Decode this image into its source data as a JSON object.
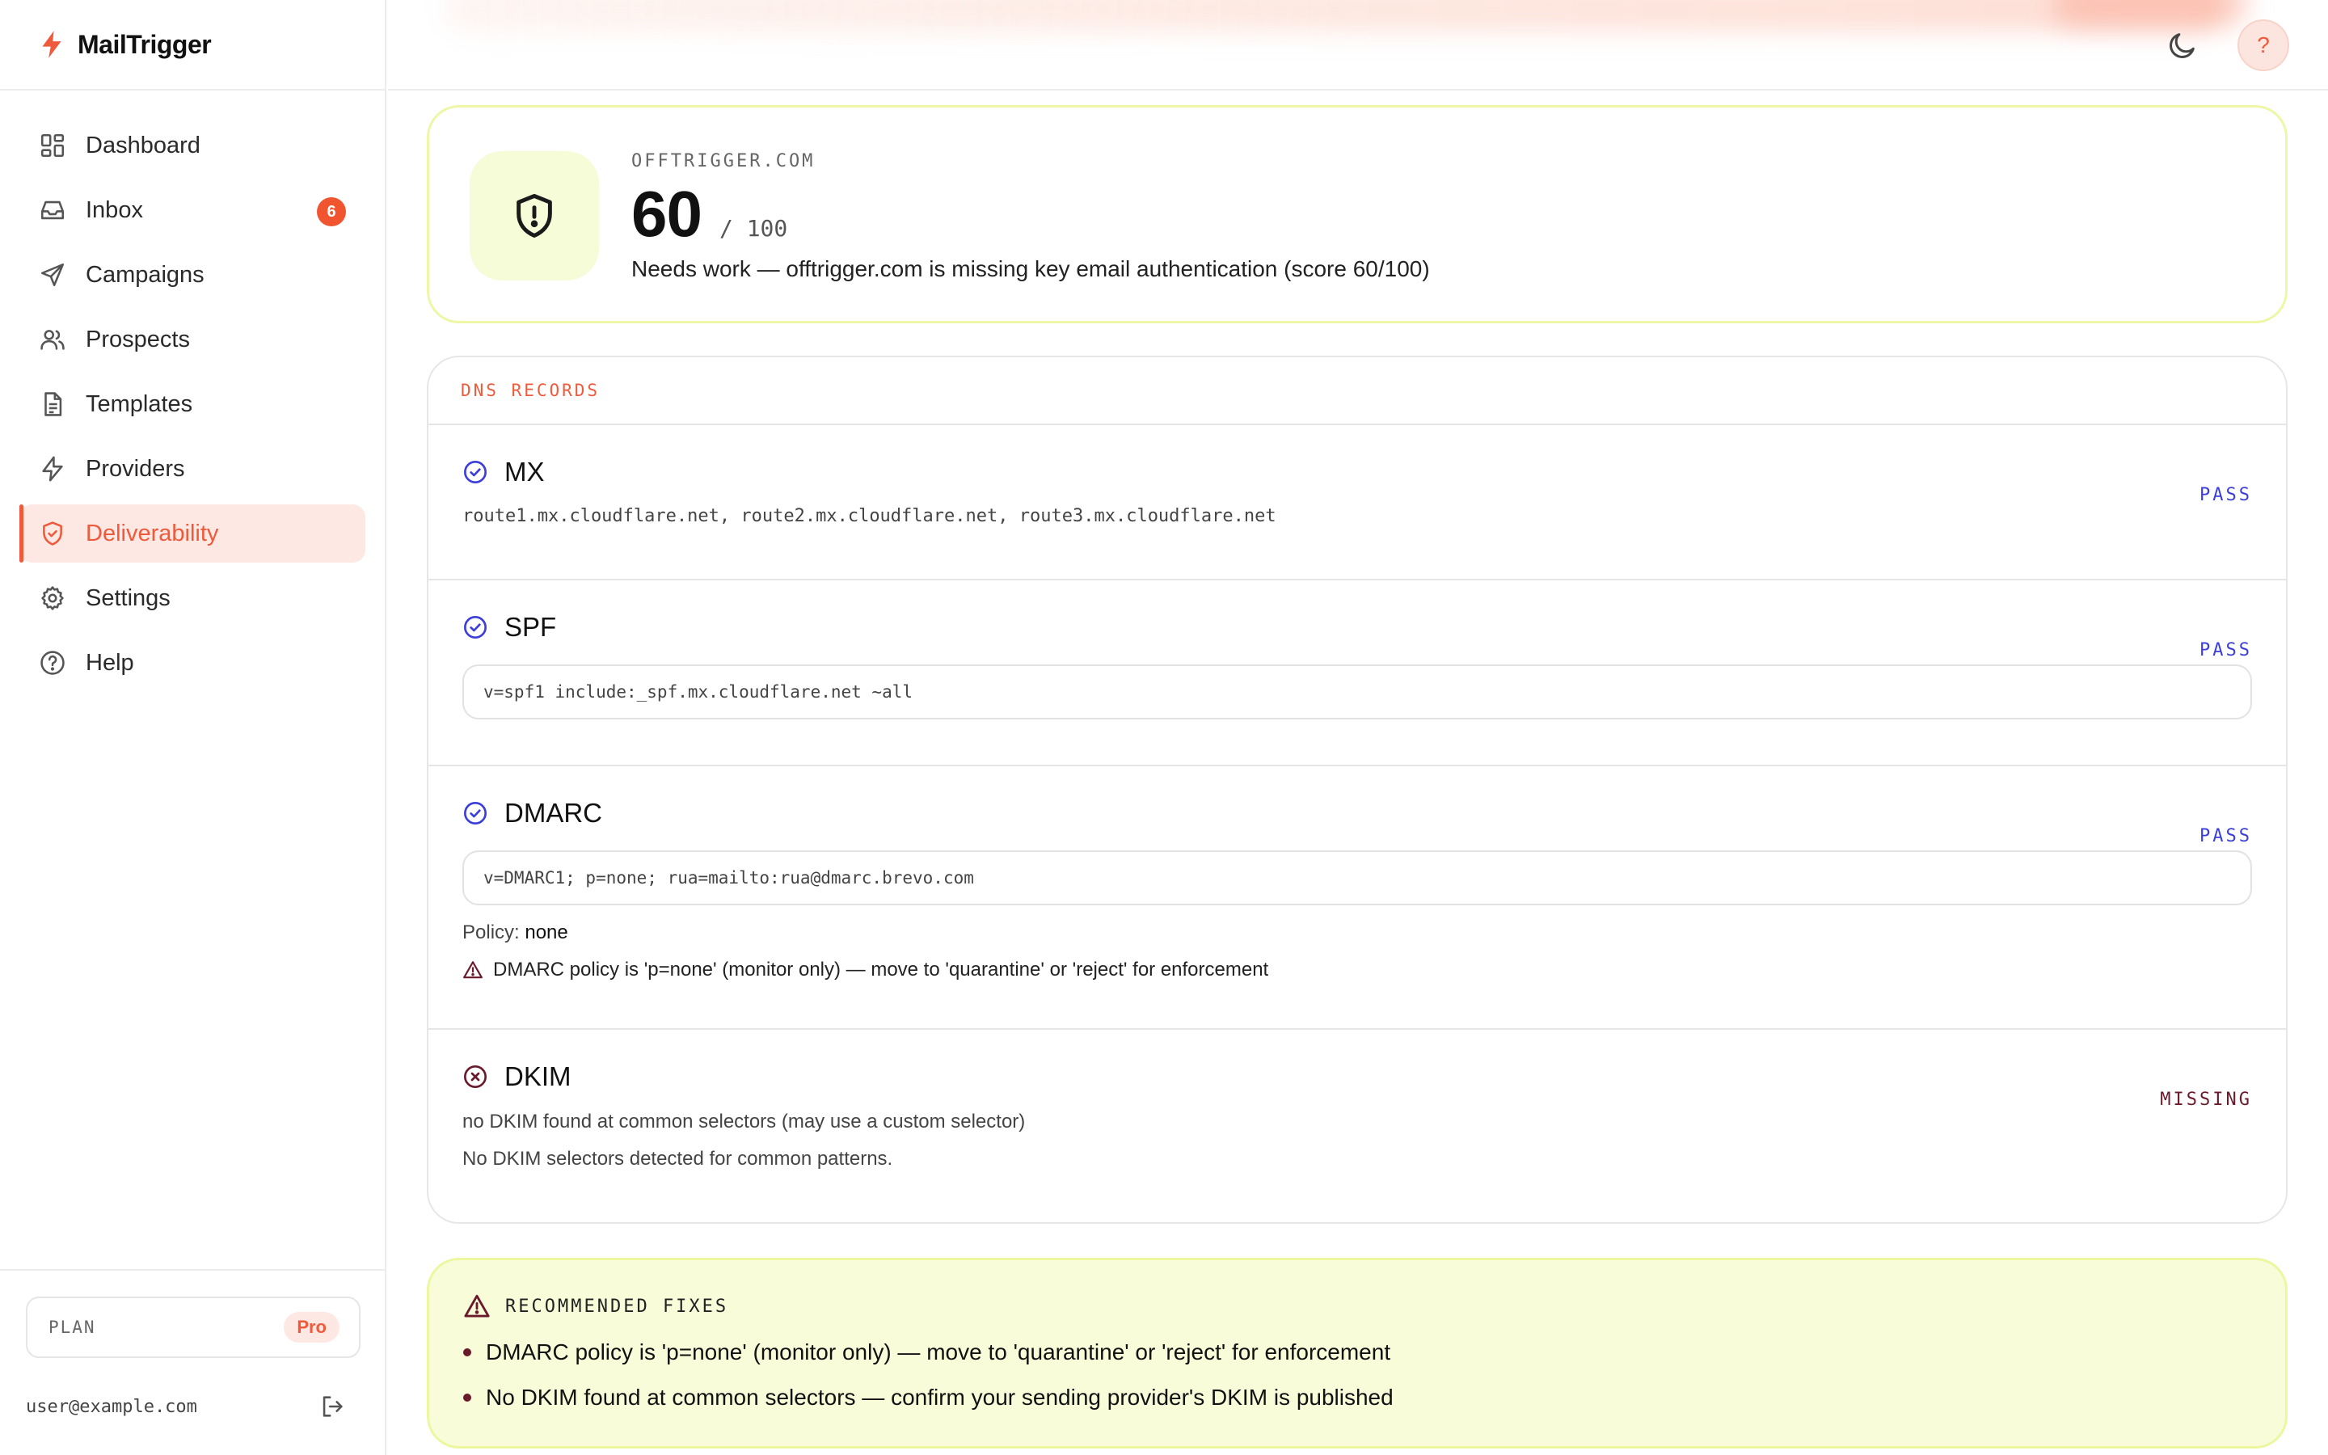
{
  "brand": {
    "name": "MailTrigger"
  },
  "sidebar": {
    "items": [
      {
        "label": "Dashboard",
        "icon": "dashboard-icon"
      },
      {
        "label": "Inbox",
        "icon": "inbox-icon",
        "badge": "6"
      },
      {
        "label": "Campaigns",
        "icon": "send-icon"
      },
      {
        "label": "Prospects",
        "icon": "users-icon"
      },
      {
        "label": "Templates",
        "icon": "document-icon"
      },
      {
        "label": "Providers",
        "icon": "bolt-icon"
      },
      {
        "label": "Deliverability",
        "icon": "shield-check-icon",
        "active": true
      },
      {
        "label": "Settings",
        "icon": "gear-icon"
      },
      {
        "label": "Help",
        "icon": "help-circle-icon"
      }
    ],
    "plan": {
      "label": "PLAN",
      "value": "Pro"
    },
    "user_email": "user@example.com"
  },
  "topbar": {
    "help_label": "?"
  },
  "score": {
    "domain": "OFFTRIGGER.COM",
    "value": "60",
    "max": "/ 100",
    "description": "Needs work — offtrigger.com is missing key email authentication (score 60/100)"
  },
  "dns": {
    "title": "DNS RECORDS",
    "records": {
      "mx": {
        "name": "MX",
        "status": "PASS",
        "value": "route1.mx.cloudflare.net, route2.mx.cloudflare.net, route3.mx.cloudflare.net"
      },
      "spf": {
        "name": "SPF",
        "status": "PASS",
        "value": "v=spf1 include:_spf.mx.cloudflare.net ~all"
      },
      "dmarc": {
        "name": "DMARC",
        "status": "PASS",
        "value": "v=DMARC1; p=none; rua=mailto:rua@dmarc.brevo.com",
        "policy_label": "Policy:",
        "policy_value": "none",
        "warning": "DMARC policy is 'p=none' (monitor only) — move to 'quarantine' or 'reject' for enforcement"
      },
      "dkim": {
        "name": "DKIM",
        "status": "MISSING",
        "detail": "no DKIM found at common selectors (may use a custom selector)",
        "note": "No DKIM selectors detected for common patterns."
      }
    }
  },
  "fixes": {
    "title": "RECOMMENDED FIXES",
    "items": [
      "DMARC policy is 'p=none' (monitor only) — move to 'quarantine' or 'reject' for enforcement",
      "No DKIM found at common selectors — confirm your sending provider's DKIM is published"
    ]
  },
  "colors": {
    "accent": "#f05a3c",
    "pass": "#3b3fd8",
    "missing": "#6b1a2c",
    "score_border": "#edf7a6",
    "fixes_bg": "#f8fcd9"
  }
}
